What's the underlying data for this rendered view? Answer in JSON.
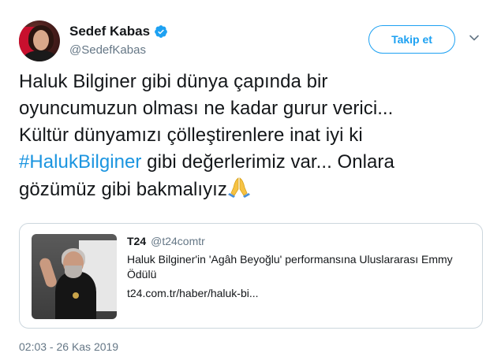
{
  "author": {
    "display_name": "Sedef Kabas",
    "handle": "@SedefKabas",
    "verified": true,
    "avatar_icon": "profile-photo"
  },
  "actions": {
    "follow_label": "Takip et",
    "menu_icon": "chevron-down-icon"
  },
  "tweet": {
    "line1": "Haluk Bilginer gibi dünya çapında bir",
    "line2": "oyuncumuzun olması ne kadar gurur verici...",
    "line3": "Kültür dünyamızı çölleştirenlere inat iyi ki",
    "hashtag": "#HalukBilginer",
    "line4_rest": " gibi değerlerimiz var... Onlara",
    "line5": "gözümüz gibi bakmalıyız",
    "emoji": "praying-hands"
  },
  "card": {
    "source_name": "T24",
    "source_handle": "@t24comtr",
    "title": "Haluk Bilginer'in 'Agâh Beyoğlu' performansına Uluslararası Emmy Ödülü",
    "url": "t24.com.tr/haber/haluk-bi..."
  },
  "timestamp": "02:03 - 26 Kas 2019",
  "colors": {
    "link": "#1b95e0",
    "accent": "#1da1f2",
    "muted": "#657786",
    "border": "#ccd6dd"
  }
}
